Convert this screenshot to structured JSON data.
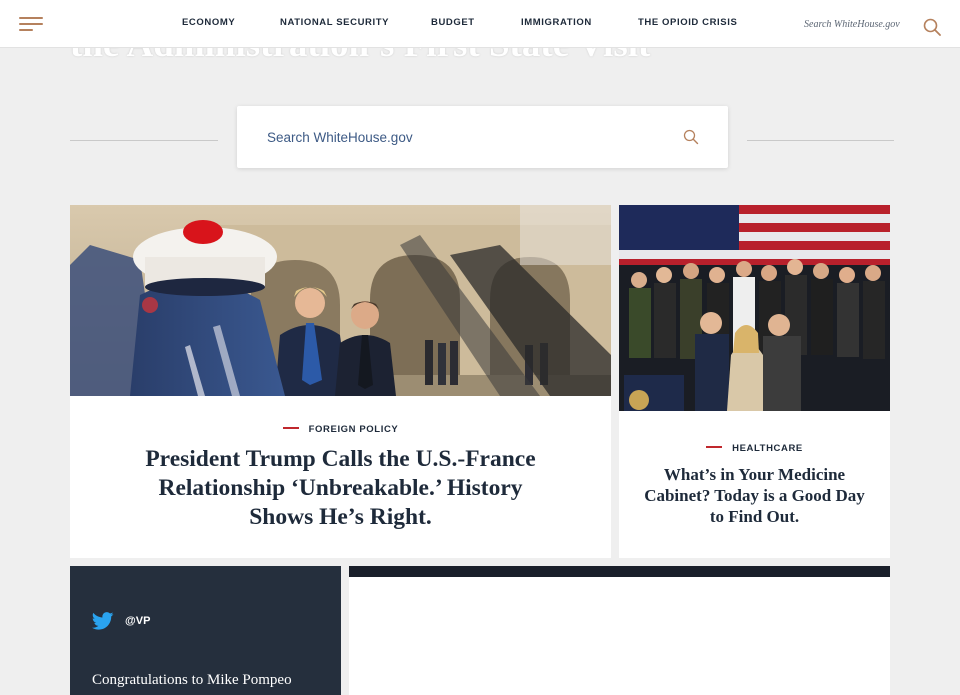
{
  "header": {
    "menu_icon": "hamburger-menu-icon",
    "nav": [
      {
        "label": "ECONOMY"
      },
      {
        "label": "NATIONAL SECURITY"
      },
      {
        "label": "BUDGET"
      },
      {
        "label": "IMMIGRATION"
      },
      {
        "label": "THE OPIOID CRISIS"
      }
    ],
    "search_placeholder": "Search WhiteHouse.gov",
    "search_icon": "search-icon",
    "accent_color": "#b5815d"
  },
  "hero": {
    "title": "the Administration’s First State Visit"
  },
  "search": {
    "placeholder": "Search WhiteHouse.gov",
    "icon": "search-icon"
  },
  "cards": [
    {
      "category": "FOREIGN POLICY",
      "headline_lines": [
        "President Trump Calls the U.S.-France",
        "Relationship ‘Unbreakable.’ History",
        "Shows He’s Right."
      ]
    },
    {
      "category": "HEALTHCARE",
      "headline_lines": [
        "What’s in Your Medicine",
        "Cabinet? Today is a Good Day",
        "to Find Out."
      ]
    }
  ],
  "tweet": {
    "icon": "twitter-bird-icon",
    "handle": "@VP",
    "text": "Congratulations to Mike Pompeo"
  },
  "colors": {
    "category_dash": "#c0282d",
    "navy": "#1e2a3a",
    "tweet_bg": "#252f3d"
  }
}
